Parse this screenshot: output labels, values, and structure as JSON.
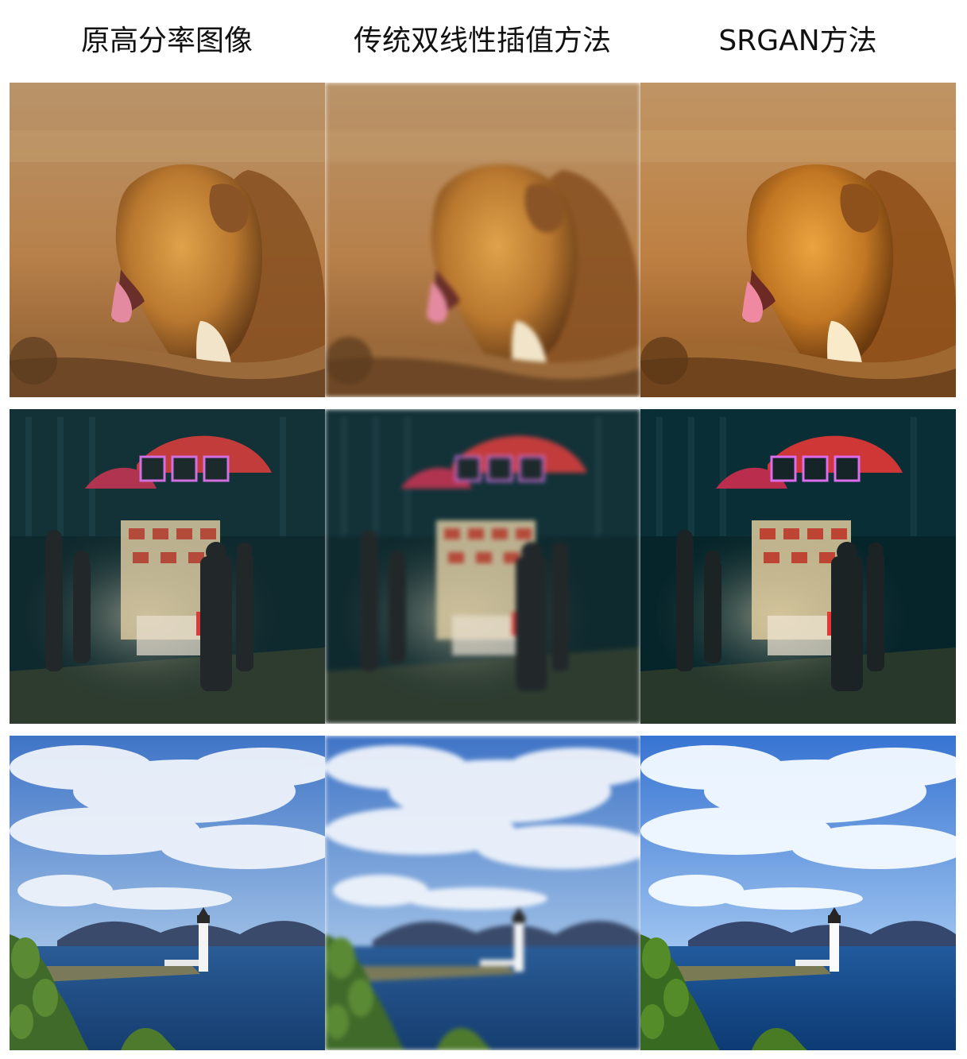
{
  "columns": [
    {
      "title": "原高分率图像"
    },
    {
      "title": "传统双线性插值方法"
    },
    {
      "title": "SRGAN方法"
    }
  ],
  "scenes": [
    {
      "name": "lion",
      "subject": "lion-icon"
    },
    {
      "name": "street-cart",
      "subject": "street-cart-icon"
    },
    {
      "name": "lighthouse",
      "subject": "lighthouse-icon"
    }
  ],
  "colors": {
    "lion_bg_top": "#b9946a",
    "lion_bg_bottom": "#a86a34",
    "lion_fur": "#c98a3a",
    "lion_fur_dark": "#7a4a1e",
    "street_bg": "#0f2a2e",
    "street_light": "#f0e6c8",
    "street_umbrella": "#c23c3c",
    "sky_top": "#3f74c6",
    "sky_bottom": "#9fc0e6",
    "cloud": "#eef3fb",
    "sea": "#1e4d86",
    "mountain": "#3a4a6a",
    "grass": "#3f6a2a",
    "lighthouse": "#f4f4f4"
  }
}
